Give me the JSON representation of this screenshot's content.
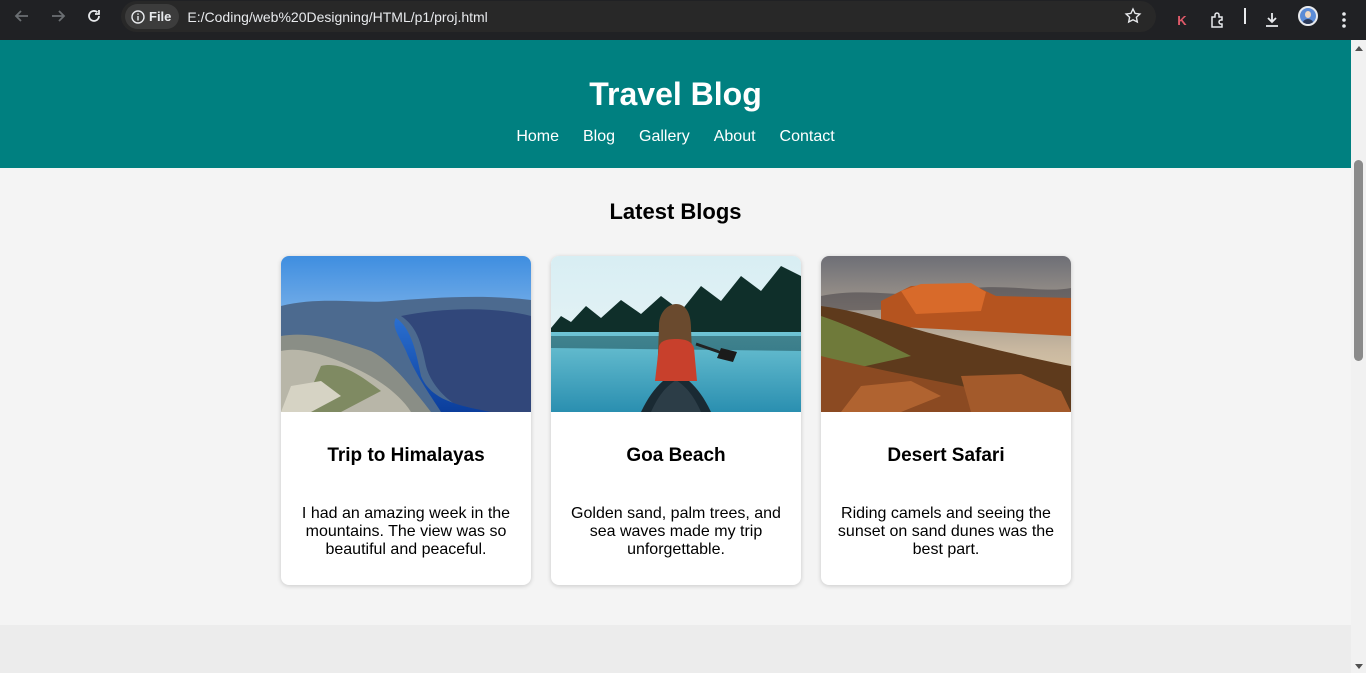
{
  "browser": {
    "file_label": "File",
    "url": "E:/Coding/web%20Designing/HTML/p1/proj.html",
    "extension_letter": "K"
  },
  "header": {
    "title": "Travel Blog",
    "nav": [
      "Home",
      "Blog",
      "Gallery",
      "About",
      "Contact"
    ]
  },
  "main": {
    "section_title": "Latest Blogs",
    "cards": [
      {
        "title": "Trip to Himalayas",
        "text": "I had an amazing week in the mountains. The view was so beautiful and peaceful."
      },
      {
        "title": "Goa Beach",
        "text": "Golden sand, palm trees, and sea waves made my trip unforgettable."
      },
      {
        "title": "Desert Safari",
        "text": "Riding camels and seeing the sunset on sand dunes was the best part."
      }
    ]
  },
  "colors": {
    "header_bg": "#008080",
    "page_bg": "#f4f4f4",
    "card_bg": "#ffffff"
  },
  "icons": [
    "back-arrow-icon",
    "forward-arrow-icon",
    "reload-icon",
    "info-icon",
    "star-icon",
    "extensions-icon",
    "download-icon",
    "kebab-menu-icon"
  ]
}
